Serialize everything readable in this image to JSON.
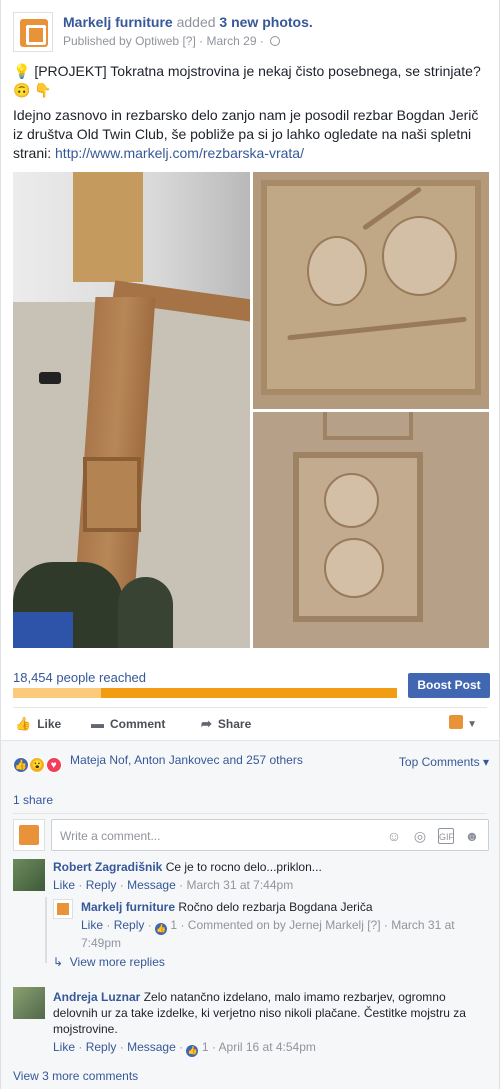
{
  "header": {
    "page_name": "Markelj furniture",
    "action_text": "added",
    "photos_text": "3 new photos.",
    "published_by_label": "Published by",
    "publisher": "Optiweb",
    "help_mark": "[?]",
    "date": "March 29",
    "sep": "·"
  },
  "post": {
    "line1": "[PROJEKT] Tokratna mojstrovina je nekaj čisto posebnega, se strinjate?",
    "para2": "Idejno zasnovo in rezbarsko delo zanjo nam je posodil rezbar Bogdan Jerič iz društva Old Twin Club, še pobliže pa si jo lahko ogledate na naši spletni strani:",
    "url": "http://www.markelj.com/rezbarska-vrata/"
  },
  "reach": {
    "text": "18,454 people reached",
    "organic_fraction": 0.23,
    "boost_label": "Boost Post"
  },
  "actions": {
    "like": "Like",
    "comment": "Comment",
    "share": "Share"
  },
  "reactions": {
    "names": "Mateja Nof, Anton Jankovec and 257 others",
    "top_comments": "Top Comments",
    "shares": "1 share"
  },
  "comment_input": {
    "placeholder": "Write a comment..."
  },
  "comments": [
    {
      "author": "Robert Zagradišnik",
      "text": "Ce je to rocno delo...priklon...",
      "like": "Like",
      "reply": "Reply",
      "message": "Message",
      "time": "March 31 at 7:44pm"
    },
    {
      "author": "Markelj furniture",
      "text": "Ročno delo rezbarja Bogdana Jeriča",
      "like": "Like",
      "reply": "Reply",
      "count": "1",
      "commented_on": "Commented on by Jernej Markelj",
      "help": "[?]",
      "time": "March 31 at 7:49pm"
    },
    {
      "author": "Andreja Luznar",
      "text": "Zelo natančno izdelano, malo imamo rezbarjev, ogromno delovnih ur za take izdelke, ki verjetno niso nikoli plačane. Čestitke mojstru za mojstrovine.",
      "like": "Like",
      "reply": "Reply",
      "message": "Message",
      "count": "1",
      "time": "April 16 at 4:54pm"
    }
  ],
  "view_more_replies": "View more replies",
  "view_more_comments": "View 3 more comments",
  "colors": {
    "link": "#365899",
    "boost": "#4267b2",
    "reach_bar": "#f29c13",
    "reach_fill": "#fbca7b"
  }
}
